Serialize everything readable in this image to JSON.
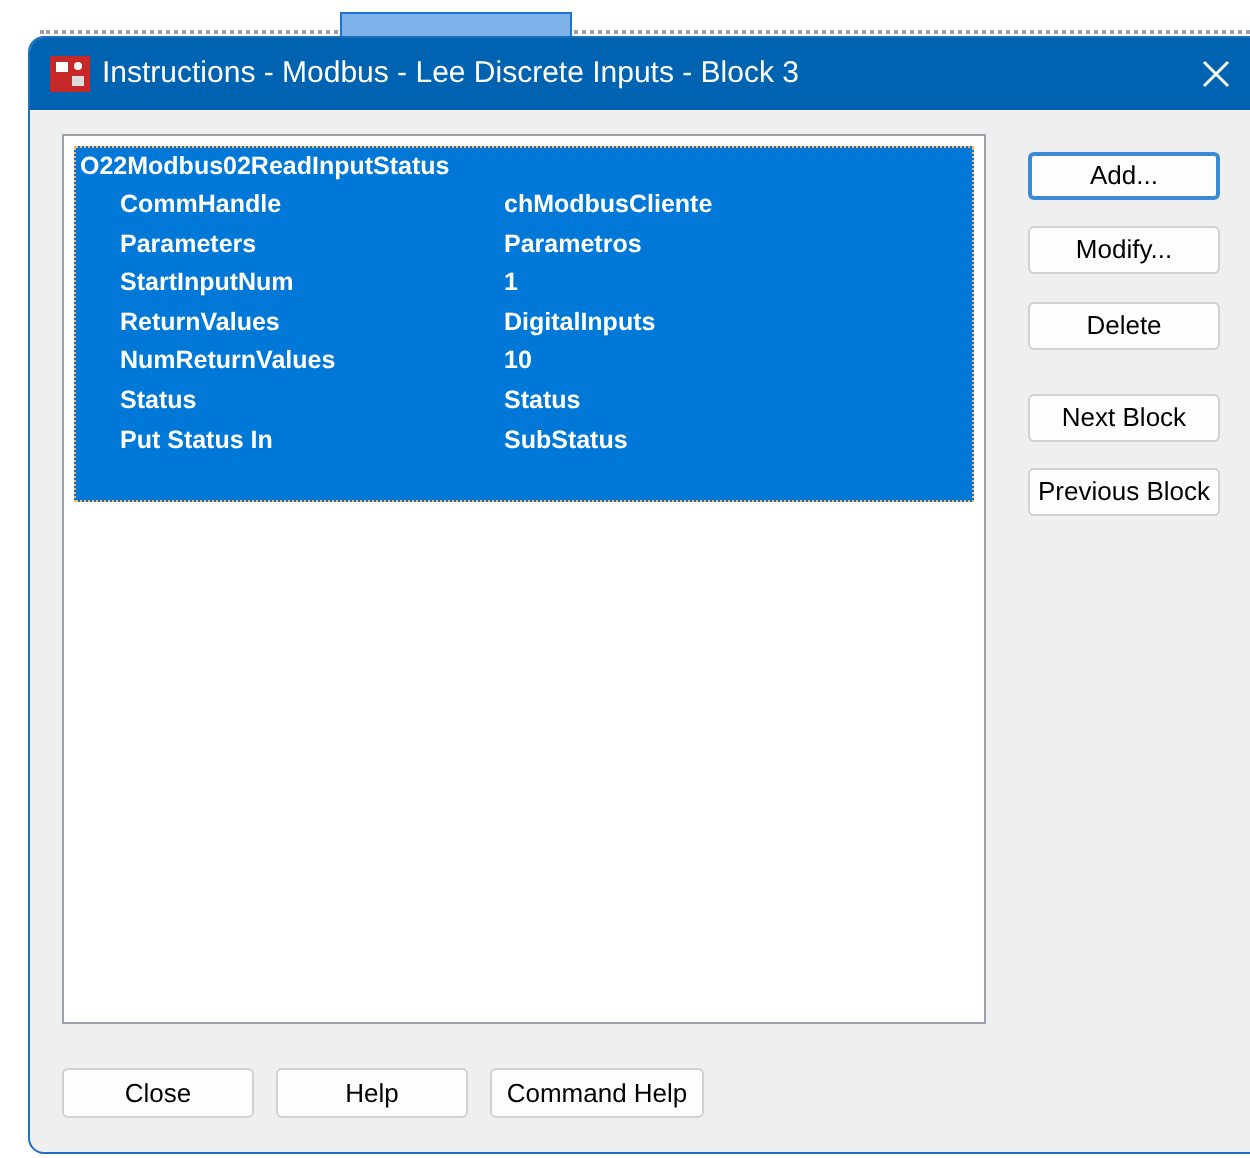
{
  "window": {
    "title": "Instructions - Modbus - Lee Discrete Inputs - Block 3"
  },
  "instructions": [
    {
      "name": "O22Modbus02ReadInputStatus",
      "selected": true,
      "params": [
        {
          "label": "CommHandle",
          "value": "chModbusCliente"
        },
        {
          "label": "Parameters",
          "value": "Parametros"
        },
        {
          "label": "StartInputNum",
          "value": "1"
        },
        {
          "label": "ReturnValues",
          "value": "DigitalInputs"
        },
        {
          "label": "NumReturnValues",
          "value": "10"
        },
        {
          "label": "Status",
          "value": "Status"
        },
        {
          "label": "Put Status In",
          "value": "SubStatus"
        }
      ]
    }
  ],
  "side_buttons": [
    {
      "label": "Add...",
      "default": true
    },
    {
      "label": "Modify...",
      "default": false
    },
    {
      "label": "Delete",
      "default": false
    },
    {
      "label": "Next Block",
      "default": false
    },
    {
      "label": "Previous Block",
      "default": false
    }
  ],
  "bottom_buttons": [
    "Close",
    "Help",
    "Command Help"
  ]
}
